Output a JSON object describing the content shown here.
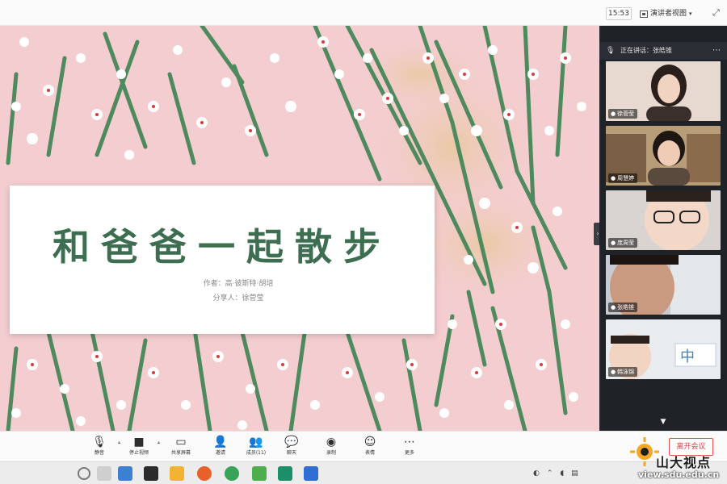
{
  "topbar": {
    "time": "15:53",
    "view_label": "演讲者视图"
  },
  "slide": {
    "title": "和爸爸一起散步",
    "author": "作者：高·彼斯特·胡培",
    "sharer": "分享人：徐菅莹"
  },
  "panel": {
    "speaking": "正在讲话：张皓锥",
    "participants": [
      {
        "name": "徐菅莹"
      },
      {
        "name": "周慧婷"
      },
      {
        "name": "庞周莹"
      },
      {
        "name": "张皓锥"
      },
      {
        "name": "韩泳锦"
      }
    ]
  },
  "toolbar": {
    "items": [
      {
        "label": "静音",
        "icon": "mic-icon"
      },
      {
        "label": "停止视频",
        "icon": "camera-icon"
      },
      {
        "label": "共享屏幕",
        "icon": "screen-share-icon"
      },
      {
        "label": "邀请",
        "icon": "invite-icon"
      },
      {
        "label": "成员(11)",
        "icon": "members-icon"
      },
      {
        "label": "聊天",
        "icon": "chat-icon"
      },
      {
        "label": "录制",
        "icon": "record-icon"
      },
      {
        "label": "表情",
        "icon": "emoji-icon"
      },
      {
        "label": "更多",
        "icon": "more-icon"
      }
    ],
    "leave_label": "离开会议"
  },
  "watermark": {
    "name": "山大视点",
    "url": "view.sdu.edu.cn"
  },
  "colors": {
    "slide_bg": "#f4cdd0",
    "stem": "#4e8a5e",
    "title": "#3e6e52",
    "panel_bg": "#1f2227",
    "leave_red": "#e04040"
  }
}
